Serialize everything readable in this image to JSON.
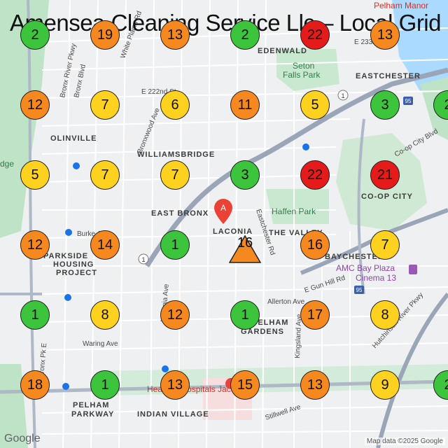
{
  "title": "Amensea Cleaning Service Llc – Local Grid",
  "attribution": "Map data ©2025 Google",
  "google_logo": "Google",
  "colors": {
    "green": "#3cc43c",
    "yellow": "#ffd21f",
    "orange": "#f5891f",
    "red": "#e51b1b"
  },
  "pin_icon": "map-pin-icon",
  "labels": {
    "neighborhoods": [
      "EDENWALD",
      "EASTCHESTER",
      "OLINVILLE",
      "WILLIAMSBRIDGE",
      "EAST BRONX",
      "LACONIA",
      "THE VALLEY",
      "CO-OP CITY",
      "PARKSIDE",
      "HOUSING",
      "PROJECT",
      "BAYCHESTER",
      "PELHAM",
      "GARDENS",
      "PELHAM",
      "PARKWAY",
      "INDIAN VILLAGE",
      "dge"
    ],
    "parks": [
      "Seton",
      "Falls Park",
      "Haffen Park"
    ],
    "streets": [
      "Bronx River Pkwy",
      "Bronx Blvd",
      "White Plains Rd",
      "Bronxwood Ave",
      "E 222nd St",
      "Eastchester Rd",
      "E Gun Hill Rd",
      "Allerton Ave",
      "Waring Ave",
      "Kingsland Ave",
      "Stillwell Ave",
      "Hutchinson River Pkwy",
      "Co-op City Blvd",
      "Burke Ave",
      "Bronx Pk E",
      "Laconia Ave",
      "E 233rd St"
    ],
    "pois": [
      "AMC Bay Plaza",
      "Cinema 13",
      "Pelham Manor",
      "Health + Hospitals Jacobi"
    ]
  },
  "grid": [
    [
      2,
      19,
      13,
      2,
      22,
      13,
      null
    ],
    [
      12,
      7,
      6,
      11,
      5,
      3,
      2
    ],
    [
      5,
      7,
      7,
      3,
      22,
      21,
      null
    ],
    [
      12,
      14,
      1,
      16,
      16,
      7,
      null
    ],
    [
      1,
      8,
      12,
      1,
      17,
      8,
      null
    ],
    [
      18,
      1,
      13,
      15,
      13,
      9,
      2
    ]
  ]
}
